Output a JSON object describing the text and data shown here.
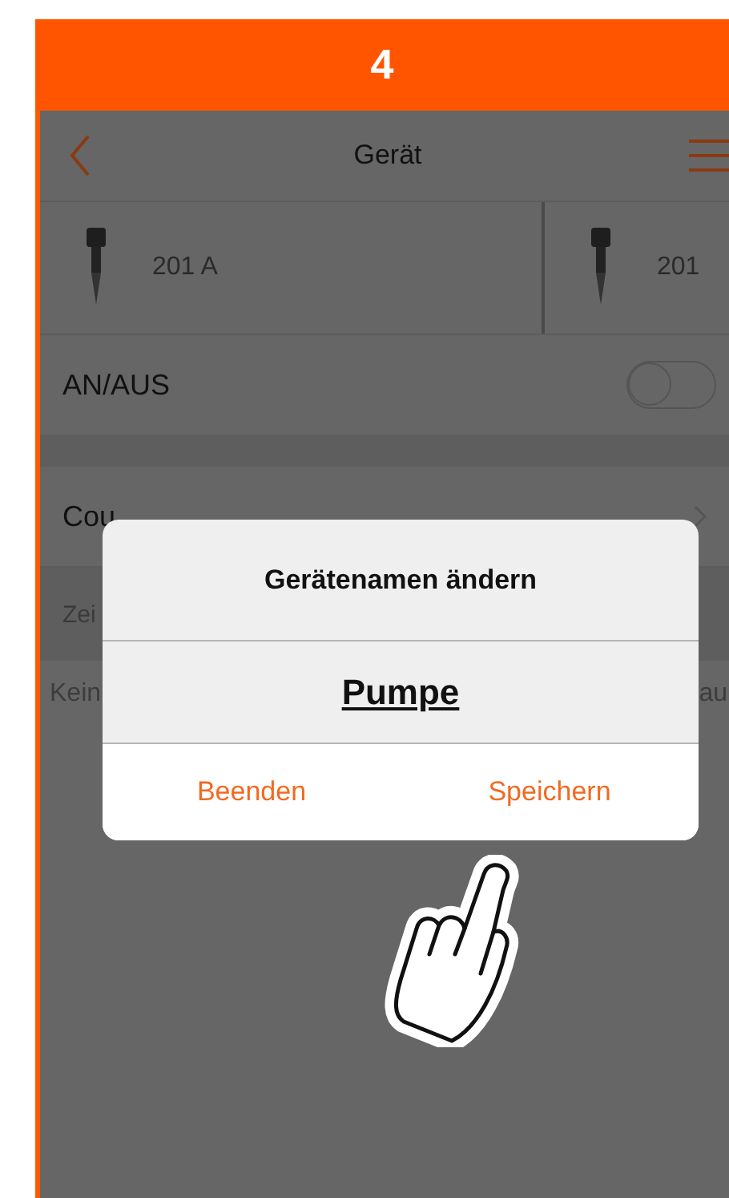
{
  "step_badge": "4",
  "nav": {
    "title": "Gerät"
  },
  "devices": [
    {
      "name": "201 A"
    },
    {
      "name": "201"
    }
  ],
  "power_row": {
    "label": "AN/AUS",
    "on": false
  },
  "countdown_row": {
    "label": "Cou"
  },
  "time_row": {
    "label": "Zei"
  },
  "empty_note": {
    "left": "Kein",
    "right": "au"
  },
  "dialog": {
    "title": "Gerätenamen ändern",
    "value": "Pumpe",
    "buttons": [
      "Beenden",
      "Speichern"
    ]
  }
}
